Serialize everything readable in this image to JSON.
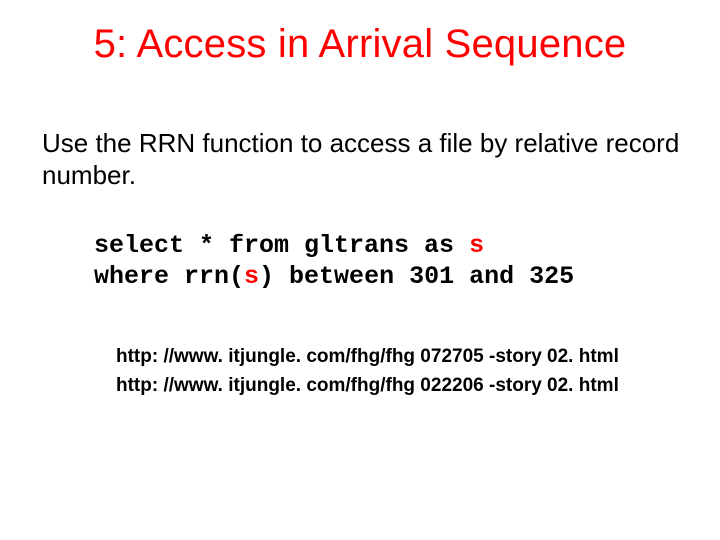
{
  "title": "5: Access in Arrival Sequence",
  "body": "Use the RRN function to access a file by relative record number.",
  "code": {
    "l1a": "select * from gltrans as ",
    "l1b": "s",
    "l2a": "where rrn(",
    "l2b": "s",
    "l2c": ") between 301 and 325"
  },
  "links": {
    "l1": "http: //www. itjungle. com/fhg/fhg 072705 -story 02. html",
    "l2": "http: //www. itjungle. com/fhg/fhg 022206 -story 02. html"
  }
}
